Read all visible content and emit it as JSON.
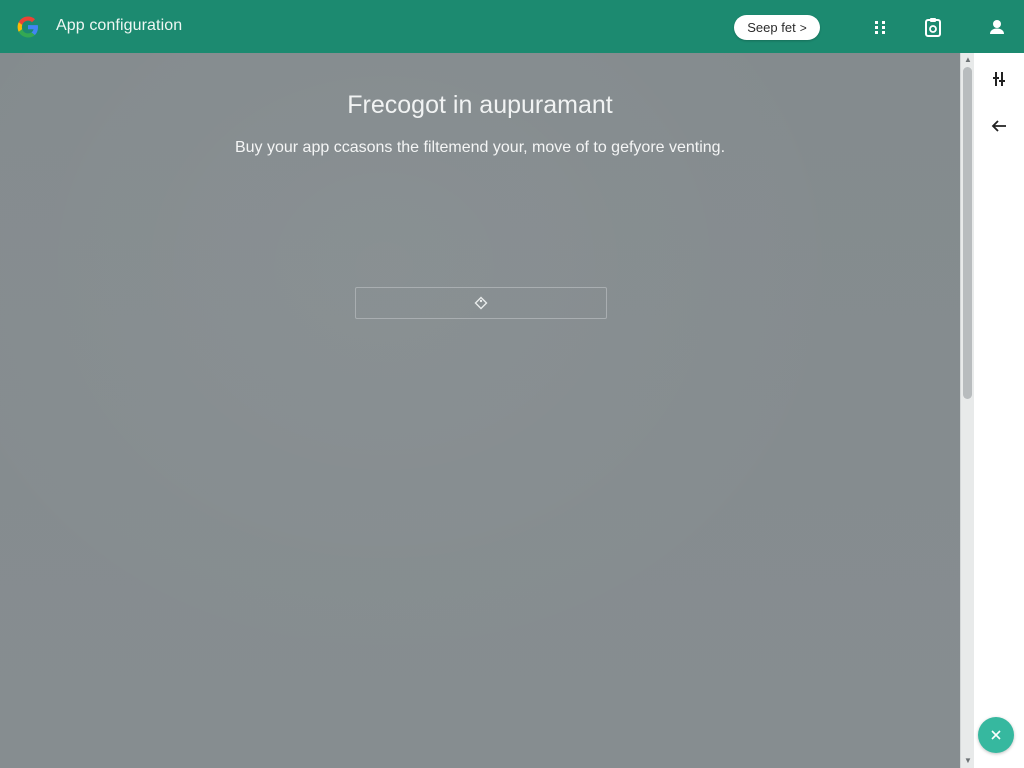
{
  "header": {
    "logo_icon": "google-g-logo",
    "title": "App configuration",
    "pill_button": {
      "label": "Seep fet",
      "icon": "chevron-right-icon"
    },
    "icons": [
      "grid-dots-icon",
      "clipboard-icon",
      "account-icon"
    ]
  },
  "main": {
    "headline": "Frecogot in aupuramant",
    "subtext": "Buy your app ccasons the filtemend your, move of to gefyore venting.",
    "field_icon": "tag-icon"
  },
  "rail": {
    "icons": [
      "sliders-icon",
      "arrow-left-icon"
    ],
    "fab_icon": "close-icon"
  },
  "colors": {
    "header_bg": "#1c8a70",
    "content_bg": "#858c8f",
    "fab_bg": "#36b89f",
    "rail_bg": "#ffffff"
  }
}
